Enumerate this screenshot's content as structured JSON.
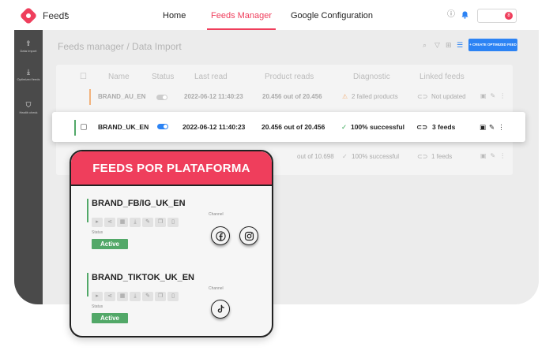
{
  "header": {
    "app_title": "Feeds",
    "nav": [
      "Home",
      "Feeds Manager",
      "Google Configuration"
    ],
    "active_nav": "Feeds Manager",
    "notification_count": "8"
  },
  "sidebar": {
    "items": [
      {
        "icon": "upload-icon",
        "label": "Data Import"
      },
      {
        "icon": "download-icon",
        "label": "Optimized feeds"
      },
      {
        "icon": "shield-icon",
        "label": "Health check"
      }
    ]
  },
  "main": {
    "title": "Feeds manager / Data Import",
    "create_button": "+ CREATE OPTIMIZED FEED"
  },
  "table": {
    "columns": [
      "Name",
      "Status",
      "Last read",
      "Product reads",
      "Diagnostic",
      "Linked feeds"
    ],
    "rows": [
      {
        "name": "BRAND_AU_EN",
        "last_read": "2022-06-12  11:40:23",
        "product_reads": "20.456 out of 20.456",
        "diagnostic": "2 failed products",
        "linked": "Not updated"
      },
      {
        "name": "BRAND_UK_EN",
        "last_read": "2022-06-12  11:40:23",
        "product_reads": "20.456 out of 20.456",
        "diagnostic": "100% successful",
        "linked": "3 feeds"
      },
      {
        "name": "",
        "last_read": "",
        "product_reads": "out of 10.698",
        "diagnostic": "100% successful",
        "linked": "1 feeds"
      }
    ]
  },
  "popup": {
    "title": "FEEDS POR PLATAFORMA",
    "channel_label": "Channel",
    "status_label": "Status",
    "feeds": [
      {
        "name": "BRAND_FB/IG_UK_EN",
        "status": "Active"
      },
      {
        "name": "BRAND_TIKTOK_UK_EN",
        "status": "Active"
      }
    ]
  },
  "colors": {
    "brand": "#ef3e5c",
    "primary": "#2c83f4",
    "success": "#52a868",
    "sidebar": "#4a4a4a"
  }
}
